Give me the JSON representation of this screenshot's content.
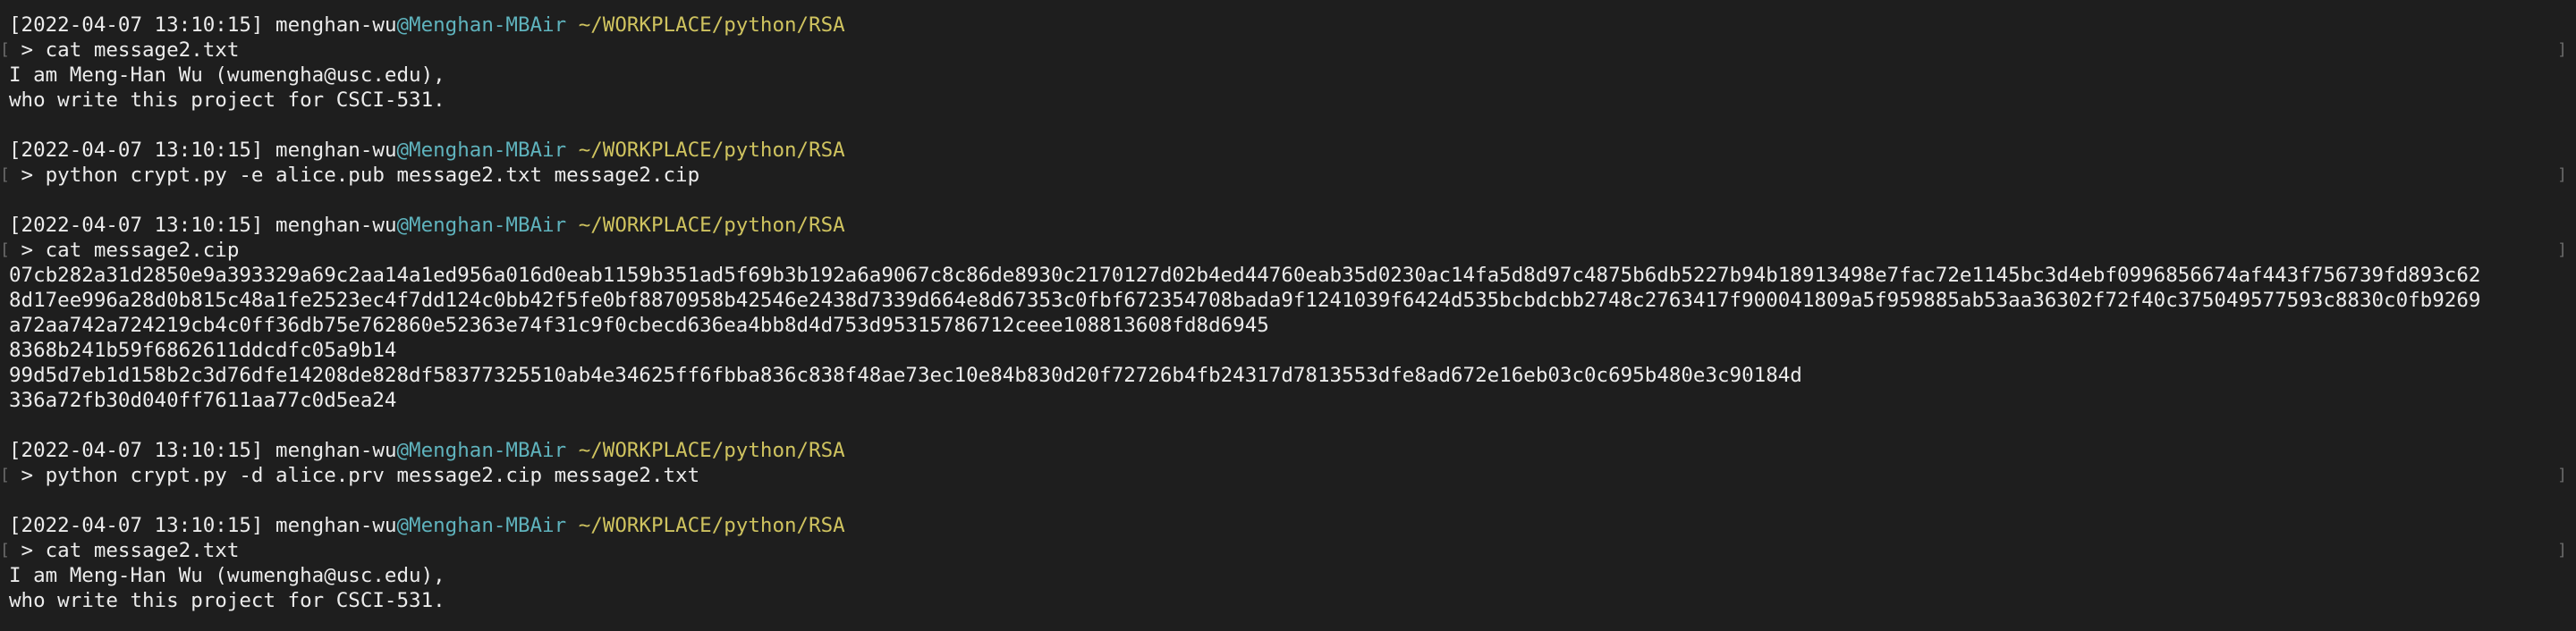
{
  "colors": {
    "background": "#1e1e1e",
    "text": "#ececec",
    "host": "#5fb3bd",
    "path": "#cfc35f",
    "bracket": "#6b6b6b"
  },
  "prompt": {
    "timestamp": "[2022-04-07 13:10:15]",
    "user": "menghan-wu",
    "host": "@Menghan-MBAir",
    "path": "~/WORKPLACE/python/RSA"
  },
  "blocks": [
    {
      "command": " > cat message2.txt",
      "output": [
        "I am Meng-Han Wu (wumengha@usc.edu),",
        "who write this project for CSCI-531."
      ]
    },
    {
      "command": " > python crypt.py -e alice.pub message2.txt message2.cip",
      "output": []
    },
    {
      "command": " > cat message2.cip",
      "output": [
        "07cb282a31d2850e9a393329a69c2aa14a1ed956a016d0eab1159b351ad5f69b3b192a6a9067c8c86de8930c2170127d02b4ed44760eab35d0230ac14fa5d8d97c4875b6db5227b94b18913498e7fac72e1145bc3d4ebf0996856674af443f756739fd893c62",
        "8d17ee996a28d0b815c48a1fe2523ec4f7dd124c0bb42f5fe0bf8870958b42546e2438d7339d664e8d67353c0fbf672354708bada9f1241039f6424d535bcbdcbb2748c2763417f900041809a5f959885ab53aa36302f72f40c375049577593c8830c0fb9269",
        "a72aa742a724219cb4c0ff36db75e762860e52363e74f31c9f0cbecd636ea4bb8d4d753d95315786712ceee108813608fd8d6945",
        "8368b241b59f6862611ddcdfc05a9b14",
        "99d5d7eb1d158b2c3d76dfe14208de828df58377325510ab4e34625ff6fbba836c838f48ae73ec10e84b830d20f72726b4fb24317d7813553dfe8ad672e16eb03c0c695b480e3c90184d",
        "336a72fb30d040ff7611aa77c0d5ea24"
      ]
    },
    {
      "command": " > python crypt.py -d alice.prv message2.cip message2.txt",
      "output": []
    },
    {
      "command": " > cat message2.txt",
      "output": [
        "I am Meng-Han Wu (wumengha@usc.edu),",
        "who write this project for CSCI-531."
      ]
    }
  ]
}
